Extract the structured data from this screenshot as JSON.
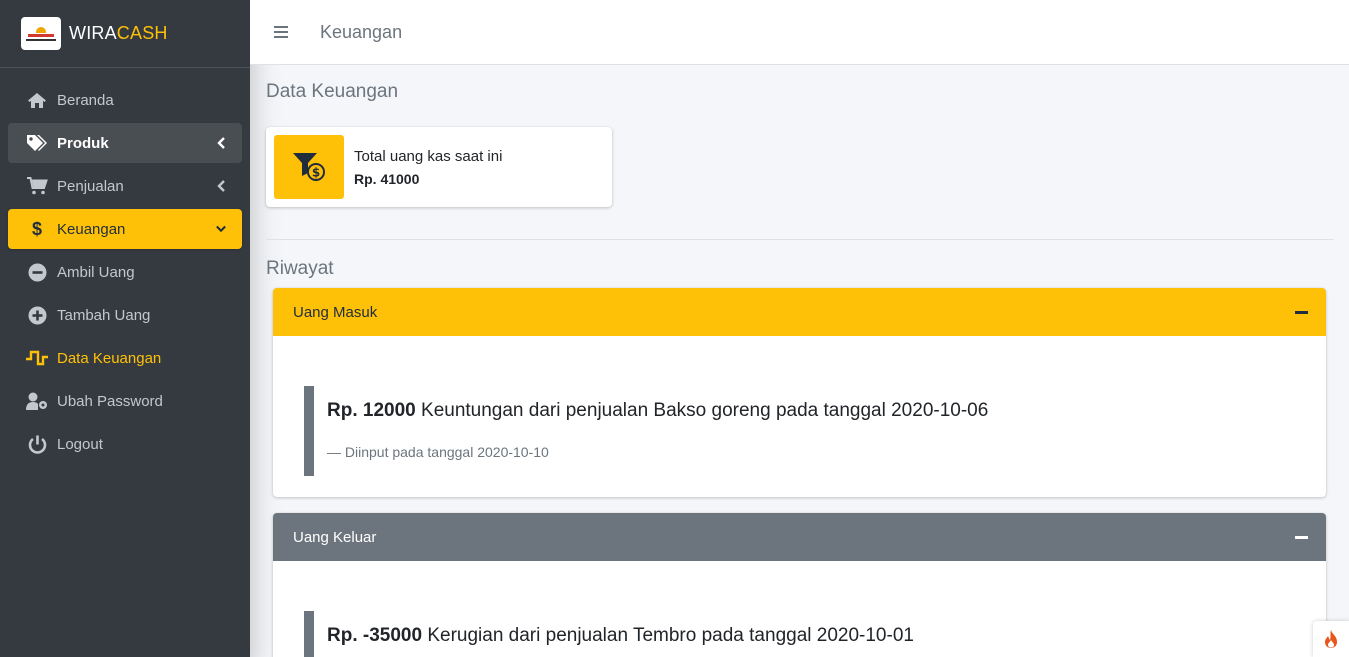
{
  "brand": {
    "name_part1": "WIRA",
    "name_part2": "CASH",
    "logo_text": "WIRACASH"
  },
  "sidebar": {
    "items": [
      {
        "label": "Beranda",
        "icon": "home-icon"
      },
      {
        "label": "Produk",
        "icon": "tags-icon"
      },
      {
        "label": "Penjualan",
        "icon": "cart-icon"
      },
      {
        "label": "Keuangan",
        "icon": "dollar-icon"
      },
      {
        "label": "Ambil Uang",
        "icon": "minus-circle-icon"
      },
      {
        "label": "Tambah Uang",
        "icon": "plus-circle-icon"
      },
      {
        "label": "Data Keuangan",
        "icon": "wave-square-icon"
      },
      {
        "label": "Ubah Password",
        "icon": "user-cog-icon"
      },
      {
        "label": "Logout",
        "icon": "power-icon"
      }
    ]
  },
  "header": {
    "title": "Keuangan"
  },
  "main": {
    "heading": "Data Keuangan",
    "info_box": {
      "label": "Total uang kas saat ini",
      "value": "Rp. 41000",
      "icon": "funnel-dollar-icon"
    },
    "history_heading": "Riwayat",
    "cards": [
      {
        "title": "Uang Masuk",
        "amount": "Rp. 12000",
        "description": "Keuntungan dari penjualan Bakso goreng pada tanggal 2020-10-06",
        "footer": "— Diinput pada tanggal 2020-10-10"
      },
      {
        "title": "Uang Keluar",
        "amount": "Rp. -35000",
        "description": "Kerugian dari penjualan Tembro pada tanggal 2020-10-01"
      }
    ]
  },
  "colors": {
    "accent": "#ffc107",
    "sidebar_bg": "#343a40",
    "secondary": "#6c757d",
    "content_bg": "#f4f6f9"
  }
}
